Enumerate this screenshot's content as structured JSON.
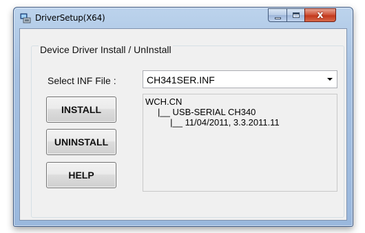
{
  "window": {
    "title": "DriverSetup(X64)",
    "controls": {
      "minimize": "minimize",
      "maximize": "maximize",
      "close": "x"
    }
  },
  "group": {
    "label": "Device Driver Install / UnInstall"
  },
  "inf_select": {
    "label": "Select INF File :",
    "value": "CH341SER.INF"
  },
  "buttons": {
    "install": "INSTALL",
    "uninstall": "UNINSTALL",
    "help": "HELP"
  },
  "info": {
    "line1": "WCH.CN",
    "line2": "     |__ USB-SERIAL CH340",
    "line3": "          |__ 11/04/2011, 3.3.2011.11"
  },
  "colors": {
    "title_bar": "#a6c1e2",
    "close_button": "#c2381c",
    "client_bg": "#f0f0f0"
  }
}
